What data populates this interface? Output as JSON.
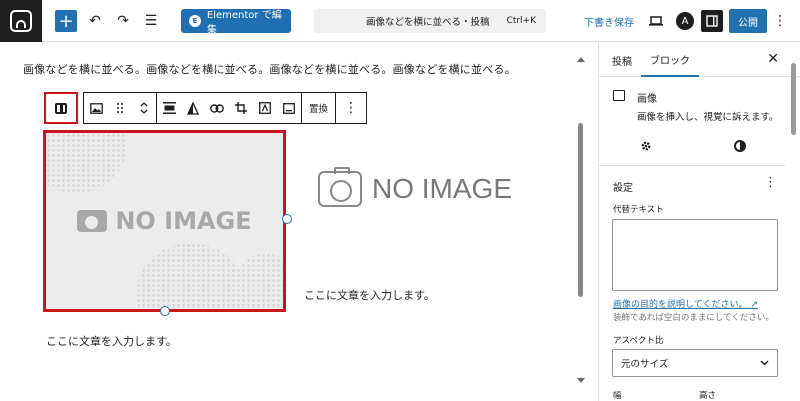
{
  "topbar": {
    "add_symbol": "+",
    "undo_symbol": "↶",
    "redo_symbol": "↷",
    "list_symbol": "☰",
    "elementor_label": "Elementor で編集",
    "elementor_badge": "E",
    "command_title": "画像などを横に並べる・投稿",
    "command_shortcut": "Ctrl+K",
    "draft_label": "下書き保存",
    "publish_label": "公開",
    "more_symbol": "⋮",
    "profile_letter": "A",
    "accent": "#2271b1"
  },
  "editor": {
    "paragraph_top": "画像などを横に並べる。画像などを横に並べる。画像などを横に並べる。画像などを横に並べる。",
    "toolbar": {
      "replace_label": "置換",
      "more_symbol": "⋮"
    },
    "noimage_big": "NO IMAGE",
    "noimage_right": "NO IMAGE",
    "caption_right": "ここに文章を入力します。",
    "caption_bottom": "ここに文章を入力します。",
    "highlight": "#c9161d"
  },
  "sidebar": {
    "tab_post": "投稿",
    "tab_block": "ブロック",
    "close_symbol": "✕",
    "block_name": "画像",
    "block_description": "画像を挿入し、視覚に訴えます。",
    "settings_title": "設定",
    "kebab_symbol": "⋮",
    "alt_text_label": "代替テキスト",
    "alt_text_value": "",
    "help_link": "画像の目的を説明してください。",
    "help_arrow": "↗",
    "help_text": "装飾であれば空白のままにしてください。",
    "aspect_label": "アスペクト比",
    "aspect_value": "元のサイズ",
    "width_label": "幅",
    "height_label": "高さ"
  }
}
